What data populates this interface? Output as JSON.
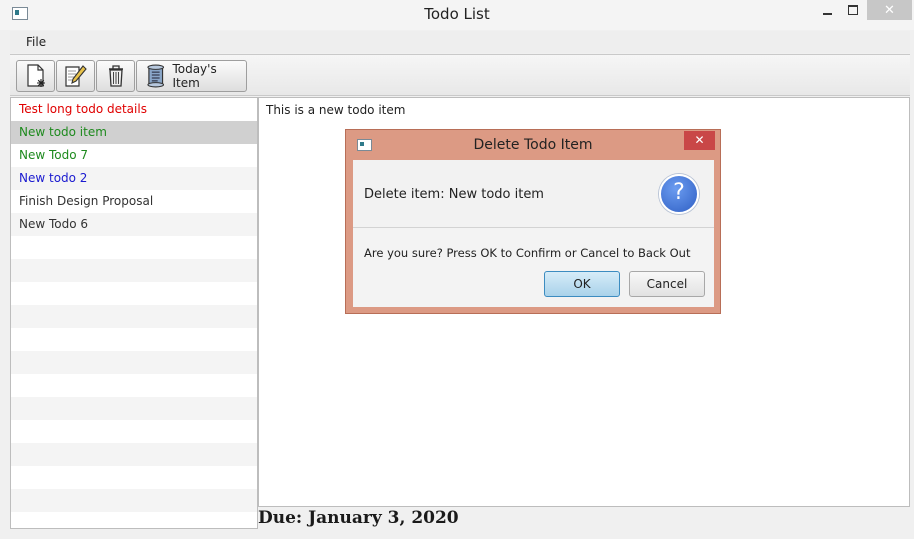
{
  "window": {
    "title": "Todo List",
    "close_glyph": "✕"
  },
  "menu": {
    "file_label": "File"
  },
  "toolbar": {
    "new_icon": "new-file-icon",
    "edit_icon": "edit-icon",
    "delete_icon": "trash-icon",
    "today_icon": "scroll-icon",
    "today_label": "Today's Item"
  },
  "todo_list": {
    "items": [
      {
        "label": "Test long todo details",
        "color": "#e00000"
      },
      {
        "label": "New todo item",
        "color": "#1e8a1e",
        "selected": true
      },
      {
        "label": "New Todo 7",
        "color": "#1e8a1e"
      },
      {
        "label": "New todo 2",
        "color": "#1a1ad0"
      },
      {
        "label": "Finish Design Proposal",
        "color": "#333333"
      },
      {
        "label": "New Todo 6",
        "color": "#333333"
      }
    ]
  },
  "details": {
    "text": "This is a new todo item",
    "due": "Due: January 3, 2020"
  },
  "dialog": {
    "title": "Delete Todo Item",
    "close_glyph": "✕",
    "header": "Delete item: New todo item",
    "question_glyph": "?",
    "message": "Are you sure? Press OK to Confirm or Cancel to Back Out",
    "ok_label": "OK",
    "cancel_label": "Cancel"
  }
}
